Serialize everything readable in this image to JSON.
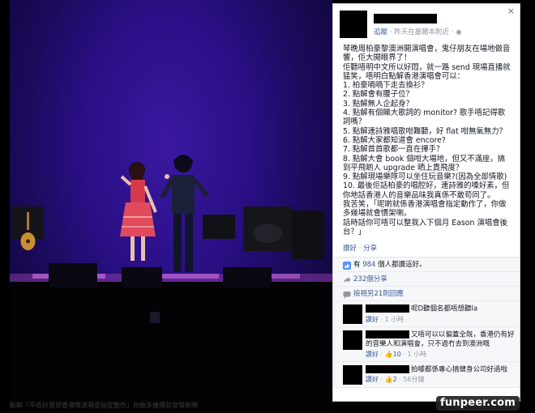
{
  "photo": {
    "caption": "點解「平唔好意思香港嘅演唱會指定動作」你做多幾場就會慣架喇"
  },
  "panel": {
    "close_glyph": "×",
    "follow_label": "追蹤",
    "meta": " · 昨天在墨爾本附近 · ",
    "post_lines": [
      "琴晚周柏豪黎澳洲開演唱會，鬼仔朋友在場地做音響，佢大開眼界了！",
      "佢聽唔明中文所以好悶，就一路 send 現場直播就猛笑，唔明白點解香港演唱會可以：",
      "1. 柏豪喎喎下走去換衫？",
      "2. 點解會有腰子位？",
      "3. 點解無人企起身？",
      "4. 點解有個睇大歌詞的 monitor? 歌手唔記得歌詞嗎？",
      "5. 點解連詩雅唱歌咁難聽，好 flat 咁無氣無力？",
      "6. 點解大家都知道會 encore?",
      "7. 點解首首歌都一直在揮手？",
      "8. 點解大會 book 個咁大場地，但又不滿座，搞到平飛啲人 upgrade 晒上貴飛度？",
      "9. 點解現場樂隊可以坐住玩音樂?(因為全部情歌)",
      "10. 最後佢話柏豪的唱腔好，連詩雅的嗓好素，但你地話香港人的音樂品味我真係不敢苟同了。",
      "我苦笑，「呢啲就係香港演唱會指定動作了，你做多幾場就會慣架喇。",
      "話時話你可唔可以整我入下個月 Eason 演唱會後台？」"
    ],
    "actions": {
      "like": "讚好",
      "sep": " · ",
      "share": "分享"
    },
    "likes": {
      "prefix": "有 ",
      "count": "984",
      "suffix": " 個人都讚這好。"
    },
    "shares": {
      "count": "232",
      "suffix": "個分享"
    },
    "more_replies": "檢視另21則回應",
    "comments": [
      {
        "text": "呢D聽個名都唔想聽la",
        "like": "讚好",
        "time": "1 小時"
      },
      {
        "text": "又唔可以以偏蓋全既，香港仍有好的音樂人和演唱會，只不過冇去到澳洲嘅",
        "like": "讚好",
        "likes": "10",
        "time": "1 小時"
      },
      {
        "text": "拍噱都係專心搞健身公司好過啦",
        "like": "讚好",
        "likes": "2",
        "time": "56分鐘"
      }
    ]
  },
  "watermark": "funpeer.com",
  "colors": {
    "link": "#3b5998",
    "meta": "#9197a3",
    "stage": "#2a0f86",
    "panel_bg": "#ffffff"
  }
}
